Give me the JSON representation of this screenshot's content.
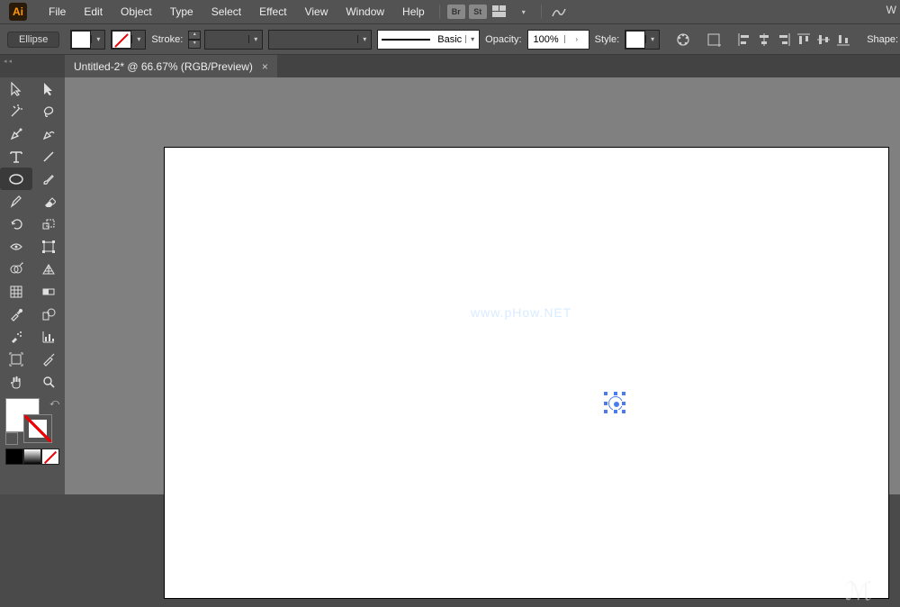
{
  "menu": {
    "items": [
      "File",
      "Edit",
      "Object",
      "Type",
      "Select",
      "Effect",
      "View",
      "Window",
      "Help"
    ],
    "right": "W"
  },
  "control": {
    "tool": "Ellipse",
    "stroke_label": "Stroke:",
    "brush_label": "Basic",
    "opacity_label": "Opacity:",
    "opacity_value": "100%",
    "style_label": "Style:",
    "shape_label": "Shape:"
  },
  "tab": {
    "title": "Untitled-2* @ 66.67% (RGB/Preview)"
  },
  "watermark": "www.pHow.NET",
  "tools": [
    [
      "selection",
      "direct-selection"
    ],
    [
      "magic-wand",
      "lasso"
    ],
    [
      "pen",
      "curvature"
    ],
    [
      "type",
      "line-segment"
    ],
    [
      "ellipse",
      "paintbrush"
    ],
    [
      "pencil",
      "eraser"
    ],
    [
      "rotate",
      "scale"
    ],
    [
      "width",
      "free-transform"
    ],
    [
      "shape-builder",
      "perspective-grid"
    ],
    [
      "mesh",
      "gradient"
    ],
    [
      "eyedropper",
      "blend"
    ],
    [
      "symbol-sprayer",
      "column-graph"
    ],
    [
      "artboard",
      "slice"
    ],
    [
      "hand",
      "zoom"
    ]
  ],
  "mini_swatches": [
    "solid",
    "gradient",
    "none"
  ]
}
